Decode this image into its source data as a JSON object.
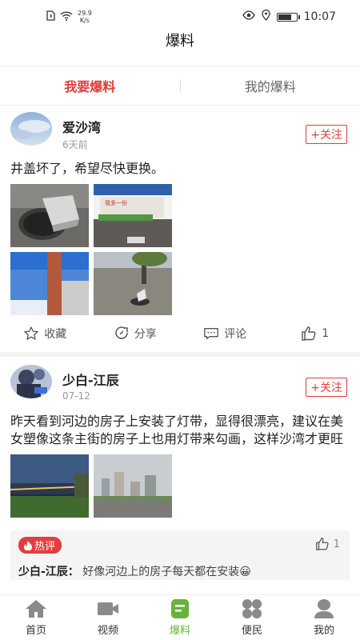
{
  "status_bar": {
    "speed_top": "29.9",
    "speed_bottom": "K/s",
    "time": "10:07"
  },
  "title": "爆料",
  "tabs": [
    {
      "label": "我要爆料",
      "active": true
    },
    {
      "label": "我的爆料",
      "active": false
    }
  ],
  "posts": [
    {
      "username": "爱沙湾",
      "time": "6天前",
      "follow_label": "+关注",
      "text": "井盖坏了，希望尽快更换。",
      "images": [
        "manhole-photo",
        "street-wall-photo",
        "blue-shutter-photo",
        "broken-manhole-photo"
      ],
      "actions": {
        "favorite": "收藏",
        "share": "分享",
        "comment": "评论",
        "likes": "1"
      }
    },
    {
      "username": "少白-江辰",
      "time": "07-12",
      "follow_label": "+关注",
      "text": "昨天看到河边的房子上安装了灯带，显得很漂亮，建议在美女塑像这条主街的房子上也用灯带来勾画，这样沙湾才更旺",
      "images": [
        "river-night-photo",
        "city-buildings-photo"
      ],
      "hot_comment": {
        "badge": "热评",
        "likes": "1",
        "author": "少白-江辰：",
        "text": "好像河边上的房子每天都在安装😀"
      }
    }
  ],
  "bottom_nav": [
    {
      "label": "首页",
      "icon": "home-icon",
      "active": false
    },
    {
      "label": "视频",
      "icon": "video-icon",
      "active": false
    },
    {
      "label": "爆料",
      "icon": "report-icon",
      "active": true
    },
    {
      "label": "便民",
      "icon": "services-icon",
      "active": false
    },
    {
      "label": "我的",
      "icon": "profile-icon",
      "active": false
    }
  ],
  "colors": {
    "accent_red": "#e33d3d",
    "nav_active_green": "#6ab23b"
  }
}
